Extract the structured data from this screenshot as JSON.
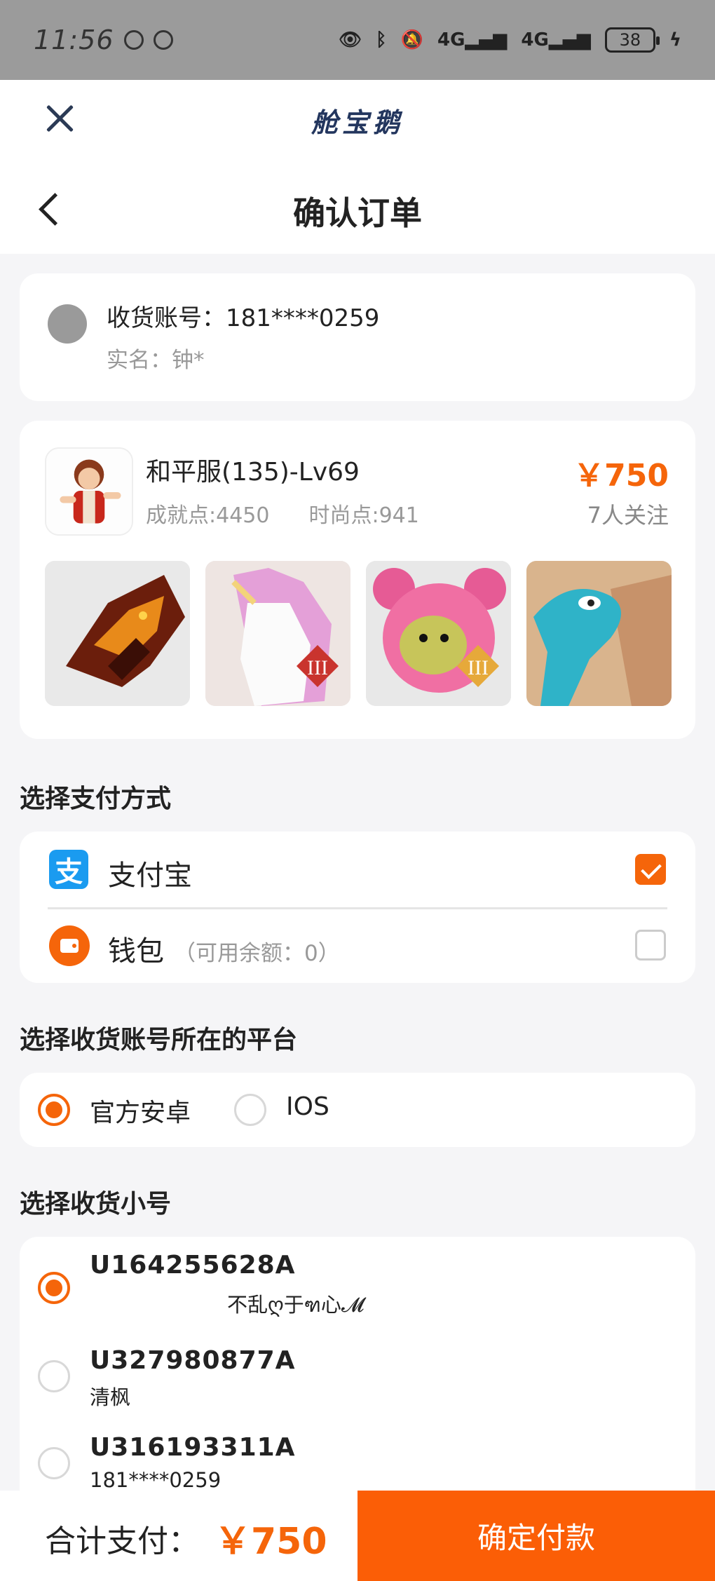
{
  "status_bar": {
    "time": "11:56",
    "battery": "38"
  },
  "browser": {
    "brand": "舱宝鹅"
  },
  "nav": {
    "title": "确认订单"
  },
  "address": {
    "account_label": "收货账号：181****0259",
    "real_name": "实名：钟*"
  },
  "goods": {
    "title": "和平服(135)-Lv69",
    "price": "￥750",
    "achievement": "成就点:4450",
    "fashion": "时尚点:941",
    "followers": "7人关注"
  },
  "payment": {
    "section_title": "选择支付方式",
    "alipay_label": "支付宝",
    "alipay_icon_glyph": "支",
    "wallet_label": "钱包",
    "wallet_balance": "（可用余额：0）",
    "selected": "alipay"
  },
  "platform": {
    "section_title": "选择收货账号所在的平台",
    "options": [
      "官方安卓",
      "IOS"
    ],
    "selected": "官方安卓"
  },
  "accounts": {
    "section_title": "选择收货小号",
    "items": [
      {
        "id": "U164255628A",
        "name": "不乱ღ于ฑ心𝓜",
        "selected": true
      },
      {
        "id": "U327980877A",
        "name": "清枫",
        "selected": false
      },
      {
        "id": "U316193311A",
        "name": "181****0259",
        "selected": false
      }
    ]
  },
  "footer": {
    "total_label": "合计支付：",
    "total_value": "￥750",
    "confirm_label": "确定付款"
  },
  "colors": {
    "accent": "#f5650a",
    "alipay_blue": "#1a9bf0"
  }
}
